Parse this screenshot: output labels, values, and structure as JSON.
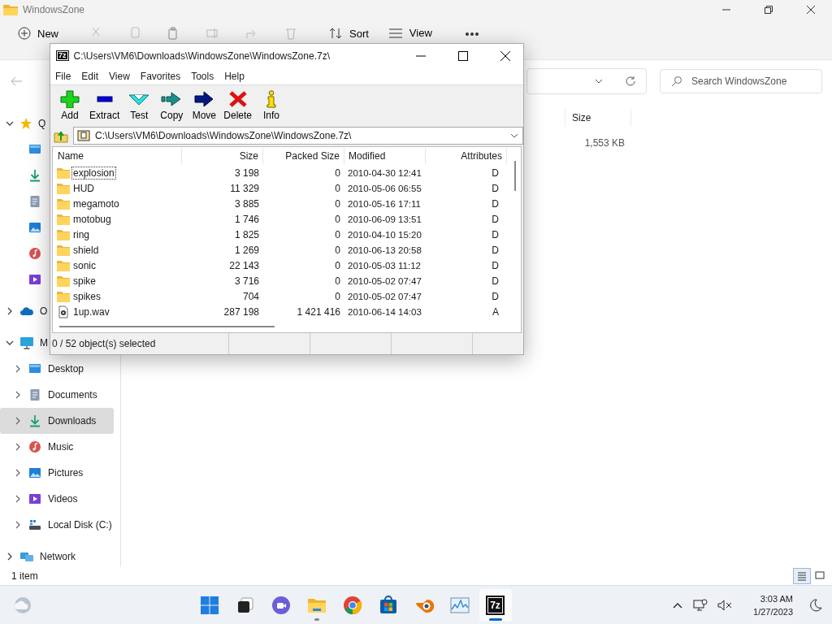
{
  "explorer": {
    "title": "WindowsZone",
    "commands": [
      {
        "label": "New",
        "kind": "new"
      },
      {
        "label": "Sort",
        "kind": "sort"
      },
      {
        "label": "View",
        "kind": "view"
      }
    ],
    "search": {
      "placeholder": "Search WindowsZone"
    },
    "sidebar": [
      {
        "kind": "star",
        "label": "Q",
        "expanded": true,
        "selected": false,
        "children": [
          {
            "kind": "desktop",
            "selected": false
          },
          {
            "kind": "download",
            "selected": false
          },
          {
            "kind": "document",
            "selected": false
          },
          {
            "kind": "picture",
            "selected": false
          },
          {
            "kind": "music",
            "selected": false
          },
          {
            "kind": "video",
            "selected": false
          }
        ]
      },
      {
        "kind": "cloud",
        "label": "O",
        "expanded": false,
        "selected": false
      },
      {
        "kind": "pc",
        "label": "M",
        "expanded": true,
        "selected": false,
        "children": [
          {
            "kind": "desktop",
            "label": "Desktop",
            "expanded": false,
            "selected": false
          },
          {
            "kind": "document",
            "label": "Documents",
            "expanded": false,
            "selected": false
          },
          {
            "kind": "download",
            "label": "Downloads",
            "expanded": false,
            "selected": true
          },
          {
            "kind": "music",
            "label": "Music",
            "expanded": false,
            "selected": false
          },
          {
            "kind": "picture",
            "label": "Pictures",
            "expanded": false,
            "selected": false
          },
          {
            "kind": "video",
            "label": "Videos",
            "expanded": false,
            "selected": false
          },
          {
            "kind": "disk",
            "label": "Local Disk (C:)",
            "expanded": false,
            "selected": false
          }
        ]
      },
      {
        "kind": "network",
        "label": "Network",
        "expanded": false,
        "selected": false
      }
    ],
    "column_header": "Size",
    "rows": [
      {
        "size": "1,553 KB"
      }
    ],
    "status": "1 item",
    "views": [
      {
        "kind": "details",
        "selected": true
      },
      {
        "kind": "tiles",
        "selected": false
      }
    ]
  },
  "archive_window": {
    "icon_text": "7z",
    "title": "C:\\Users\\VM6\\Downloads\\WindowsZone\\WindowsZone.7z\\",
    "menu": [
      "File",
      "Edit",
      "View",
      "Favorites",
      "Tools",
      "Help"
    ],
    "tools": [
      {
        "label": "Add",
        "kind": "add"
      },
      {
        "label": "Extract",
        "kind": "extract"
      },
      {
        "label": "Test",
        "kind": "test"
      },
      {
        "label": "Copy",
        "kind": "copy"
      },
      {
        "label": "Move",
        "kind": "move"
      },
      {
        "label": "Delete",
        "kind": "delete"
      },
      {
        "label": "Info",
        "kind": "info"
      }
    ],
    "path": "C:\\Users\\VM6\\Downloads\\WindowsZone\\WindowsZone.7z\\",
    "columns": [
      "Name",
      "Size",
      "Packed Size",
      "Modified",
      "Attributes"
    ],
    "rows": [
      {
        "kind": "folder",
        "name": "explosion",
        "size": "3 198",
        "packed": "0",
        "modified": "2010-04-30 12:41",
        "attributes": "D",
        "focused": true
      },
      {
        "kind": "folder",
        "name": "HUD",
        "size": "11 329",
        "packed": "0",
        "modified": "2010-05-06 06:55",
        "attributes": "D",
        "focused": false
      },
      {
        "kind": "folder",
        "name": "megamoto",
        "size": "3 885",
        "packed": "0",
        "modified": "2010-05-16 17:11",
        "attributes": "D",
        "focused": false
      },
      {
        "kind": "folder",
        "name": "motobug",
        "size": "1 746",
        "packed": "0",
        "modified": "2010-06-09 13:51",
        "attributes": "D",
        "focused": false
      },
      {
        "kind": "folder",
        "name": "ring",
        "size": "1 825",
        "packed": "0",
        "modified": "2010-04-10 15:20",
        "attributes": "D",
        "focused": false
      },
      {
        "kind": "folder",
        "name": "shield",
        "size": "1 269",
        "packed": "0",
        "modified": "2010-06-13 20:58",
        "attributes": "D",
        "focused": false
      },
      {
        "kind": "folder",
        "name": "sonic",
        "size": "22 143",
        "packed": "0",
        "modified": "2010-05-03 11:12",
        "attributes": "D",
        "focused": false
      },
      {
        "kind": "folder",
        "name": "spike",
        "size": "3 716",
        "packed": "0",
        "modified": "2010-05-02 07:47",
        "attributes": "D",
        "focused": false
      },
      {
        "kind": "folder",
        "name": "spikes",
        "size": "704",
        "packed": "0",
        "modified": "2010-05-02 07:47",
        "attributes": "D",
        "focused": false
      },
      {
        "kind": "file",
        "name": "1up.wav",
        "size": "287 198",
        "packed": "1 421 416",
        "modified": "2010-06-14 14:03",
        "attributes": "A",
        "focused": false
      }
    ],
    "status": "0 / 52 object(s) selected"
  },
  "taskbar": {
    "apps": [
      {
        "kind": "start",
        "running": false,
        "selected": false
      },
      {
        "kind": "taskview",
        "running": false,
        "selected": false
      },
      {
        "kind": "chat",
        "running": false,
        "selected": false
      },
      {
        "kind": "explorer",
        "running": true,
        "selected": false
      },
      {
        "kind": "chrome",
        "running": false,
        "selected": false
      },
      {
        "kind": "store",
        "running": false,
        "selected": false
      },
      {
        "kind": "blender",
        "running": false,
        "selected": false
      },
      {
        "kind": "monitor",
        "running": false,
        "selected": false
      },
      {
        "kind": "sevenzip",
        "label": "7z",
        "running": true,
        "selected": true
      }
    ],
    "time": "3:03 AM",
    "date": "1/27/2023"
  }
}
